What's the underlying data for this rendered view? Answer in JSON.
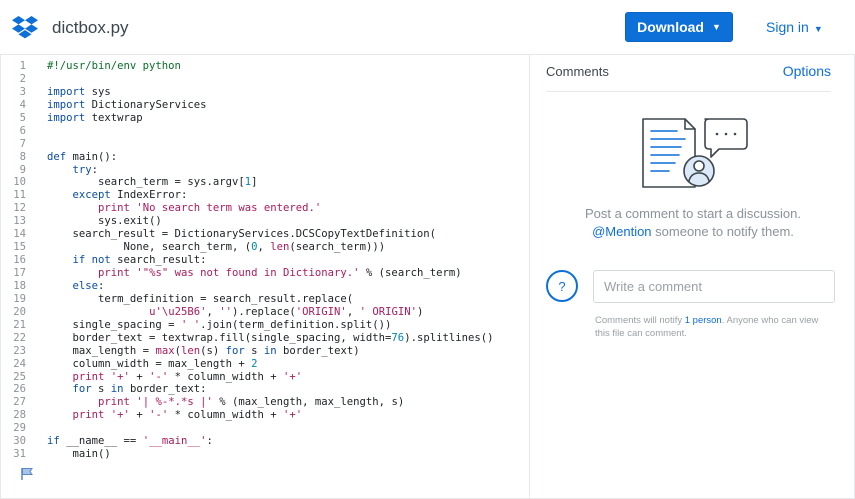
{
  "header": {
    "file_name": "dictbox.py",
    "download_label": "Download",
    "signin_label": "Sign in"
  },
  "colors": {
    "accent": "#0d6fd8",
    "keyword": "#0b4ea2",
    "string": "#a71d5d"
  },
  "code_lines": [
    {
      "n": "1",
      "html": "<span class=\"cm\">#!/usr/bin/env python</span>"
    },
    {
      "n": "2",
      "html": ""
    },
    {
      "n": "3",
      "html": "<span class=\"kw\">import</span> sys"
    },
    {
      "n": "4",
      "html": "<span class=\"kw\">import</span> DictionaryServices"
    },
    {
      "n": "5",
      "html": "<span class=\"kw\">import</span> textwrap"
    },
    {
      "n": "6",
      "html": ""
    },
    {
      "n": "7",
      "html": ""
    },
    {
      "n": "8",
      "html": "<span class=\"kw\">def</span> main():"
    },
    {
      "n": "9",
      "html": "    <span class=\"kw\">try</span>:"
    },
    {
      "n": "10",
      "html": "        search_term = sys.argv[<span class=\"num\">1</span>]"
    },
    {
      "n": "11",
      "html": "    <span class=\"kw\">except</span> IndexError:"
    },
    {
      "n": "12",
      "html": "        <span class=\"bi\">print</span> <span class=\"str\">'No search term was entered.'</span>"
    },
    {
      "n": "13",
      "html": "        sys.exit()"
    },
    {
      "n": "14",
      "html": "    search_result = DictionaryServices.DCSCopyTextDefinition("
    },
    {
      "n": "15",
      "html": "            None, search_term, (<span class=\"num\">0</span>, <span class=\"bi\">len</span>(search_term)))"
    },
    {
      "n": "16",
      "html": "    <span class=\"kw\">if not</span> search_result:"
    },
    {
      "n": "17",
      "html": "        <span class=\"bi\">print</span> <span class=\"str\">'\"%s\" was not found in Dictionary.'</span> % (search_term)"
    },
    {
      "n": "18",
      "html": "    <span class=\"kw\">else</span>:"
    },
    {
      "n": "19",
      "html": "        term_definition = search_result.replace("
    },
    {
      "n": "20",
      "html": "                <span class=\"str\">u'\\u25B6'</span>, <span class=\"str\">''</span>).replace(<span class=\"str\">'ORIGIN'</span>, <span class=\"str\">' ORIGIN'</span>)"
    },
    {
      "n": "21",
      "html": "    single_spacing = <span class=\"str\">' '</span>.join(term_definition.split())"
    },
    {
      "n": "22",
      "html": "    border_text = textwrap.fill(single_spacing, width=<span class=\"num\">76</span>).splitlines()"
    },
    {
      "n": "23",
      "html": "    max_length = <span class=\"bi\">max</span>(<span class=\"bi\">len</span>(s) <span class=\"kw\">for</span> s <span class=\"kw\">in</span> border_text)"
    },
    {
      "n": "24",
      "html": "    column_width = max_length + <span class=\"num\">2</span>"
    },
    {
      "n": "25",
      "html": "    <span class=\"bi\">print</span> <span class=\"str\">'+'</span> + <span class=\"str\">'-'</span> * column_width + <span class=\"str\">'+'</span>"
    },
    {
      "n": "26",
      "html": "    <span class=\"kw\">for</span> s <span class=\"kw\">in</span> border_text:"
    },
    {
      "n": "27",
      "html": "        <span class=\"bi\">print</span> <span class=\"str\">'| %-*.*s |'</span> % (max_length, max_length, s)"
    },
    {
      "n": "28",
      "html": "    <span class=\"bi\">print</span> <span class=\"str\">'+'</span> + <span class=\"str\">'-'</span> * column_width + <span class=\"str\">'+'</span>"
    },
    {
      "n": "29",
      "html": ""
    },
    {
      "n": "30",
      "html": "<span class=\"kw\">if</span> __name__ == <span class=\"str\">'__main__'</span>:"
    },
    {
      "n": "31",
      "html": "    main()"
    }
  ],
  "comments": {
    "title": "Comments",
    "options_label": "Options",
    "empty_line1": "Post a comment to start a discussion.",
    "empty_mention": "@Mention",
    "empty_line2_rest": " someone to notify them.",
    "avatar_glyph": "?",
    "input_placeholder": "Write a comment",
    "notify_prefix": "Comments will notify ",
    "notify_person": "1 person",
    "notify_suffix": ". Anyone who can view this file can comment."
  },
  "icons": {
    "logo": "dropbox-logo-icon",
    "flag": "flag-icon",
    "illustration": "document-comment-illustration-icon"
  }
}
